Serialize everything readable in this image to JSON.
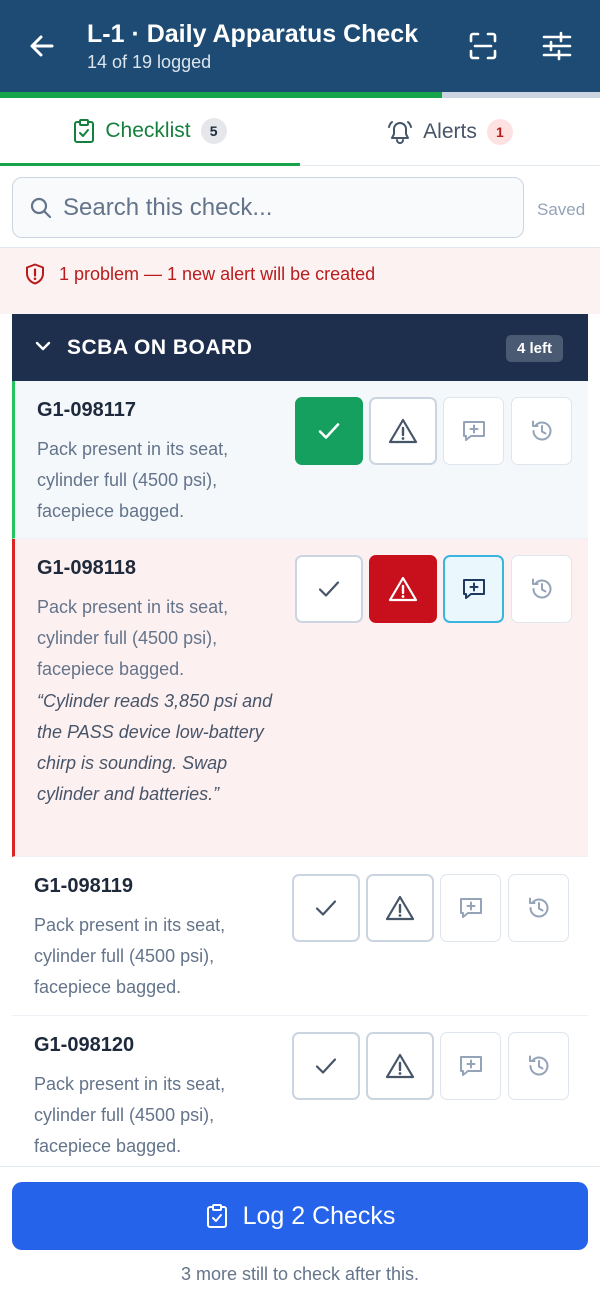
{
  "header": {
    "title": "L-1 · Daily Apparatus Check",
    "subtitle": "14 of 19 logged",
    "progress_fraction": 0.737,
    "accent_color": "#1e4b73"
  },
  "tabs": [
    {
      "label": "Checklist",
      "count": "5",
      "icon": "clipboard-check-icon",
      "active": true
    },
    {
      "label": "Alerts",
      "count": "1",
      "icon": "bell-icon",
      "active": false
    }
  ],
  "search": {
    "placeholder": "Search this check...",
    "value": "",
    "saved_label": "Saved"
  },
  "banner": {
    "text": "1 problem — 1 new alert will be created",
    "icon": "shield-alert-icon",
    "color": "#b91c1c"
  },
  "section": {
    "title": "SCBA ON BOARD",
    "badge": "4 left"
  },
  "items": [
    {
      "id": "G1-098117",
      "desc": "Pack present in its seat, cylinder full (4500 psi), facepiece bagged.",
      "status": "ok",
      "note": ""
    },
    {
      "id": "G1-098118",
      "desc": "Pack present in its seat, cylinder full (4500 psi), facepiece bagged.",
      "status": "problem",
      "note": "“Cylinder reads 3,850 psi and the PASS device low-battery chirp is sounding. Swap cylinder and batteries.”"
    },
    {
      "id": "G1-098119",
      "desc": "Pack present in its seat, cylinder full (4500 psi), facepiece bagged.",
      "status": "pending",
      "note": ""
    },
    {
      "id": "G1-098120",
      "desc": "Pack present in its seat, cylinder full (4500 psi), facepiece bagged.",
      "status": "pending",
      "note": ""
    }
  ],
  "colors": {
    "ok_green": "#15a05f",
    "problem_red": "#c8101c",
    "primary_blue": "#2563eb"
  },
  "footer": {
    "button_label": "Log 2 Checks",
    "note": "3 more still to check after this."
  }
}
